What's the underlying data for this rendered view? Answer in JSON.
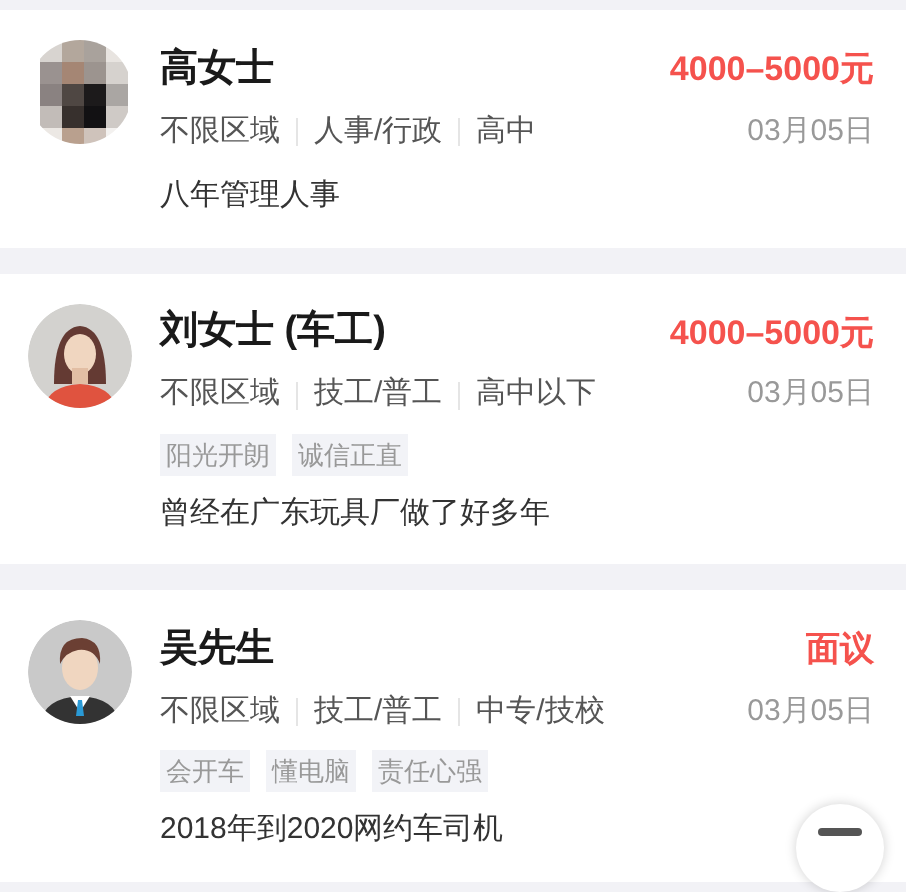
{
  "candidates": [
    {
      "name": "高女士",
      "salary": "4000–5000元",
      "meta": [
        "不限区域",
        "人事/行政",
        "高中"
      ],
      "date": "03月05日",
      "description": "八年管理人事"
    },
    {
      "kind": "female",
      "name": "刘女士 (车工)",
      "salary": "4000–5000元",
      "meta": [
        "不限区域",
        "技工/普工",
        "高中以下"
      ],
      "date": "03月05日",
      "tags": [
        "阳光开朗",
        "诚信正直"
      ],
      "description": "曾经在广东玩具厂做了好多年"
    },
    {
      "kind": "male",
      "name": "吴先生",
      "salary": "面议",
      "meta": [
        "不限区域",
        "技工/普工",
        "中专/技校"
      ],
      "date": "03月05日",
      "tags": [
        "会开车",
        "懂电脑",
        "责任心强"
      ],
      "description": "2018年到2020网约车司机"
    }
  ]
}
